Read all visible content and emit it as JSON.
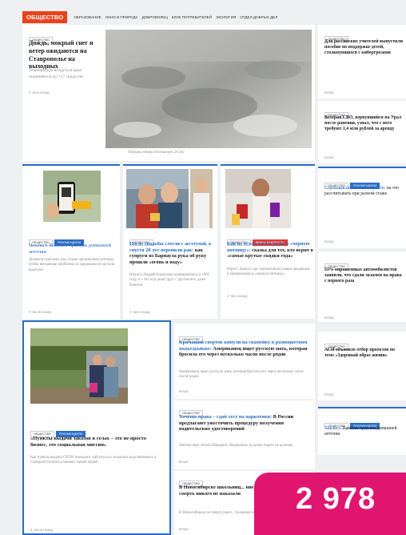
{
  "nav": {
    "brand": "ОБЩЕСТВО",
    "links": [
      "ОБРАЗОВАНИЕ",
      "ОКНО В ПРИРОДУ",
      "ДОБРОВОЛЕЦ",
      "КЛУБ ПОТРЕБИТЕЛЕЙ",
      "ЭКОЛОГИЯ",
      "ОТДЕЛ ДОБРЫХ ДЕЛ"
    ]
  },
  "tags": {
    "society": "ОБЩЕСТВО",
    "recommend": "РЕКОМЕНДУЕМ",
    "important": "ВАЖНАЯ НОВОСТЬ"
  },
  "lead": {
    "title": "Дождь, мокрый снег и ветер ожидаются на Ставрополье на выходных",
    "subtitle": "Температура воздуха в крае поднимется до +17 градусов",
    "time": "2 часа назад",
    "caption": "Порывы ветра достигнут 20 м/с"
  },
  "right": [
    {
      "title": "Для российских учителей выпустили пособие по поддержке детей, столкнувшихся с кибергрозами",
      "time": "вчера"
    },
    {
      "title": "Ветеран СВО, вернувшийся на Урал после ранения, узнал, что с него требуют 1,4 млн рублей за аренду",
      "time": "вчера"
    },
    {
      "title_hl": "Страховая пенсия по старости:",
      "title": " на что рассчитывать при разном стаже",
      "time": "вчера"
    },
    {
      "title": "53% опрошенных автомобилистов заявили, что сдали экзамен на права с первого раза",
      "time": "вчера"
    },
    {
      "title": "АСИ объявило отбор проектов по теме «Здоровый образ жизни»",
      "time": "вчера"
    },
    {
      "title_hl": "Чеклист.",
      "title": " Важные правила домашней аптечки",
      "time": "вчера"
    }
  ],
  "mid": [
    {
      "title": "Чеклист. Важные правила домашней аптечки",
      "subtitle": "Делимся советами, как лучше организовать аптечку, чтобы внезапные проблемы со здоровьем не застали врасплох",
      "time": "9 часов назад"
    },
    {
      "title_hl": "После свадьбы слегли с желтухой, а спустя 28 лет перенили рак:",
      "title": " как супруги из Барнаула рука об руку прошли «огонь и воду»",
      "subtitle": "Юлия и Андрей Борисовы познакомились в 1995 году, и с тех пор делят друг с другом всё, даже болезни",
      "time": "4 часа назад"
    },
    {
      "title_hl": "Как не остаться без денег в «черную пятницу»:",
      "title": " сказка для тех, кто верит в «самые крутые скидки года»",
      "subtitle": "Юрист Диана Сорс перечисляла уловки продавцов и мошенников в «черную пятницу»",
      "time": "3 часа назад"
    }
  ],
  "bigleft": {
    "title": "«Пункты выдачи заказов в селах – это не просто бизнес, это социальная миссия»",
    "subtitle": "Как пункты выдачи OZON помогают заботиться о пожилых родственниках в Северной Осетии и меняют жизни людей",
    "time": "9 часов назад"
  },
  "list": [
    {
      "title_hl": "Кричащий сверток кинули на скамейку в разноцветном подъездъньке:",
      "title": " Американец ищет русскую мать, которая бросила его через несколько часов после родов",
      "subtitle": "Американец ищет русскую мать, которая бросила его через несколько часов после родов",
      "time": "вчера"
    },
    {
      "title_hl": "Хочешь права – сдай тест на наркотики:",
      "title": " В России предлагают ужесточить процедуру получения водительских удостоверений",
      "subtitle": "Автоэксперт Антон Шапарин: Нарколины за рулем ездить не должны",
      "time": "вчера"
    },
    {
      "title": "В Новосибирске школьниц... ние, пока врач заполнял... смерть никого не наказали",
      "subtitle": "В Новосибирске за смерть школ... больнице никого не наказали",
      "time": "вчера"
    }
  ],
  "counter": "2 978",
  "colors": {
    "brand": "#e8431c",
    "accent": "#2b6cc4",
    "counter": "#e01570"
  }
}
